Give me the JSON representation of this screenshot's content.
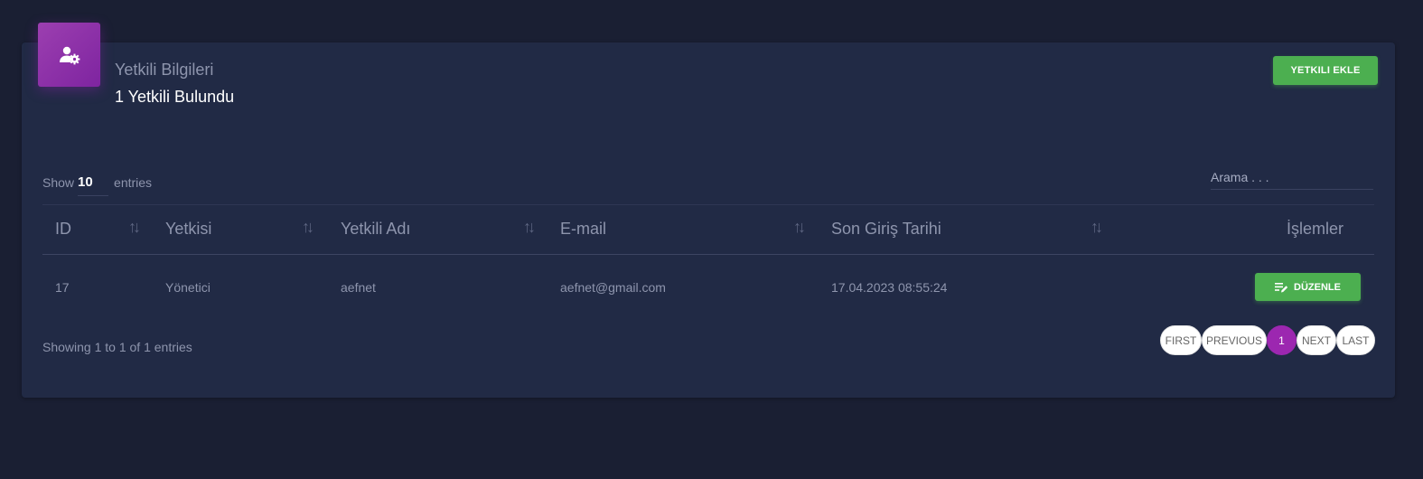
{
  "header": {
    "title": "Yetkili Bilgileri",
    "subtitle": "1 Yetkili Bulundu",
    "add_button": "YETKILI EKLE",
    "icon": "user-gear-icon",
    "accent_color": "#9c27b0",
    "button_color": "#4caf50"
  },
  "length": {
    "prefix": "Show",
    "value": "10",
    "suffix": "entries"
  },
  "search": {
    "placeholder": "Arama . . ."
  },
  "table": {
    "columns": [
      "ID",
      "Yetkisi",
      "Yetkili Adı",
      "E-mail",
      "Son Giriş Tarihi",
      "İşlemler"
    ],
    "rows": [
      {
        "id": "17",
        "yetkisi": "Yönetici",
        "ad": "aefnet",
        "email": "aefnet@gmail.com",
        "son_giris": "17.04.2023 08:55:24",
        "edit_label": "DÜZENLE"
      }
    ]
  },
  "info": "Showing 1 to 1 of 1 entries",
  "pagination": {
    "first": "FIRST",
    "previous": "PREVIOUS",
    "current": "1",
    "next": "NEXT",
    "last": "LAST"
  }
}
